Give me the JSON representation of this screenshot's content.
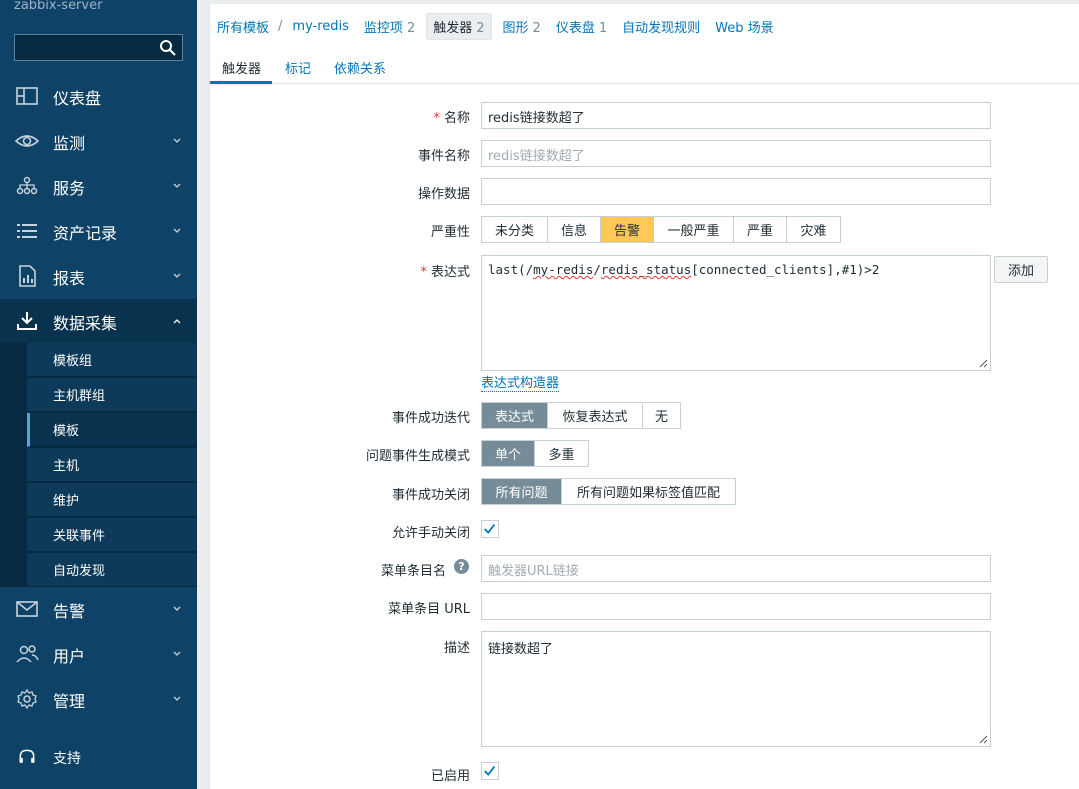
{
  "sidebar": {
    "logo": "zabbix-server",
    "search_placeholder": "",
    "menu": [
      {
        "label": "仪表盘"
      },
      {
        "label": "监测"
      },
      {
        "label": "服务"
      },
      {
        "label": "资产记录"
      },
      {
        "label": "报表"
      },
      {
        "label": "数据采集"
      },
      {
        "label": "告警"
      },
      {
        "label": "用户"
      },
      {
        "label": "管理"
      },
      {
        "label": "支持"
      }
    ],
    "submenu": [
      "模板组",
      "主机群组",
      "模板",
      "主机",
      "维护",
      "关联事件",
      "自动发现"
    ]
  },
  "nav": {
    "all_templates": "所有模板",
    "separator": "/",
    "template": "my-redis",
    "items_label": "监控项",
    "items_count": "2",
    "triggers_label": "触发器",
    "triggers_count": "2",
    "graphs_label": "图形",
    "graphs_count": "2",
    "dashboards_label": "仪表盘",
    "dashboards_count": "1",
    "discovery_label": "自动发现规则",
    "web_label": "Web 场景"
  },
  "tabs": [
    "触发器",
    "标记",
    "依赖关系"
  ],
  "form": {
    "name_label": "名称",
    "name_value": "redis链接数超了",
    "event_name_label": "事件名称",
    "event_name_placeholder": "redis链接数超了",
    "opdata_label": "操作数据",
    "opdata_value": "",
    "severity_label": "严重性",
    "severity_options": [
      "未分类",
      "信息",
      "告警",
      "一般严重",
      "严重",
      "灾难"
    ],
    "severity_selected": "告警",
    "expression_label": "表达式",
    "expression_prefix": "last(/",
    "expression_host": "my-redis",
    "expression_sep": "/",
    "expression_key": "redis_status",
    "expression_suffix": "[connected_clients],#1)>2",
    "add_button": "添加",
    "expr_builder_link": "表达式构造器",
    "ok_event_gen_label": "事件成功迭代",
    "ok_event_gen_options": [
      "表达式",
      "恢复表达式",
      "无"
    ],
    "ok_event_gen_selected": "表达式",
    "problem_mode_label": "问题事件生成模式",
    "problem_mode_options": [
      "单个",
      "多重"
    ],
    "problem_mode_selected": "单个",
    "ok_close_label": "事件成功关闭",
    "ok_close_options": [
      "所有问题",
      "所有问题如果标签值匹配"
    ],
    "ok_close_selected": "所有问题",
    "manual_close_label": "允许手动关闭",
    "manual_close_checked": true,
    "url_name_label": "菜单条目名",
    "url_name_placeholder": "触发器URL链接",
    "url_label": "菜单条目 URL",
    "url_value": "",
    "desc_label": "描述",
    "desc_value": "链接数超了",
    "enabled_label": "已启用",
    "enabled_checked": true
  },
  "colors": {
    "sidebar_bg": "#0e4367",
    "link": "#0275b8",
    "warning": "#ffc859",
    "selected_gray": "#768d99"
  }
}
